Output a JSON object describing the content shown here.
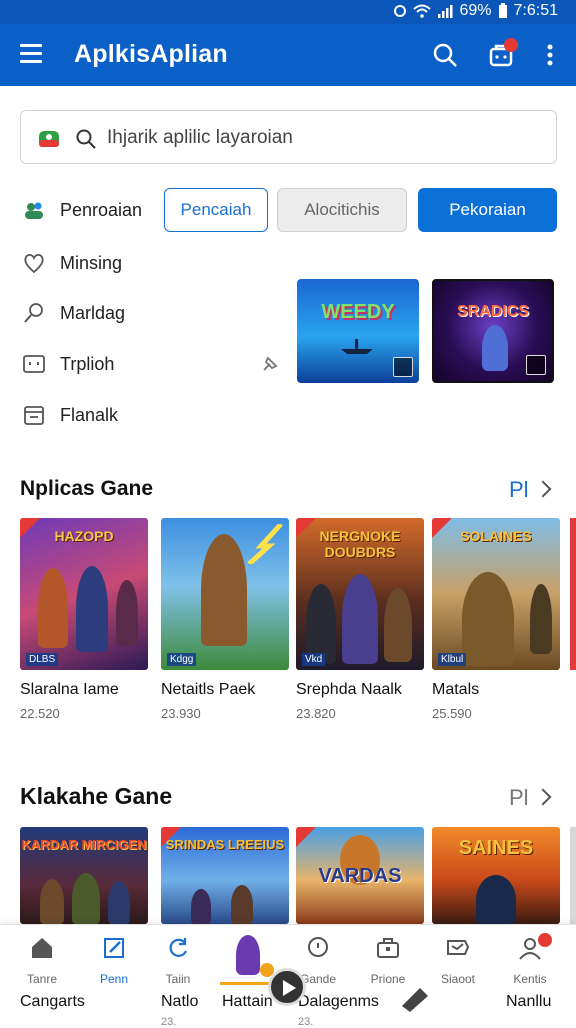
{
  "status_bar": {
    "battery": "69%",
    "time": "7:6:51"
  },
  "app_bar": {
    "title": "AplkisAplian",
    "cart_badge": ""
  },
  "search": {
    "placeholder": "Ihjarik aplilic layaroian"
  },
  "sidebar": {
    "items": [
      {
        "label": "Penroaian",
        "icon": "people-icon"
      },
      {
        "label": "Minsing",
        "icon": "heart-icon"
      },
      {
        "label": "Marldag",
        "icon": "magnifier-icon"
      },
      {
        "label": "Trplioh",
        "icon": "screen-icon"
      },
      {
        "label": "Flanalk",
        "icon": "calendar-icon"
      }
    ]
  },
  "chips": {
    "first": "Pencaiah",
    "second": "Alocitichis",
    "third": "Pekoraian"
  },
  "featured": [
    {
      "title": "WEEDY"
    },
    {
      "title": "SRADICS"
    }
  ],
  "sections": {
    "popular": {
      "title": "Nplicas Gane",
      "more": "Pl",
      "cards": [
        {
          "name": "Slaralna Iame",
          "count": "22.520",
          "art_text": "HAZOPD",
          "tag": "DLBS"
        },
        {
          "name": "Netaitls Paek",
          "count": "23.930",
          "art_text": "",
          "tag": "Kdgg"
        },
        {
          "name": "Srephda Naalk",
          "count": "23.820",
          "art_text": "NERGNOKE DOUBDRS",
          "tag": "Vkd"
        },
        {
          "name": "Matals",
          "count": "25.590",
          "art_text": "SOLAINES",
          "tag": "Klbul"
        }
      ]
    },
    "second": {
      "title": "Klakahe Gane",
      "more": "Pl",
      "cards": [
        {
          "art_text": "KARDAR MIRCIGEN"
        },
        {
          "art_text": "SRINDAS LREEIUS"
        },
        {
          "art_text": "VARDAS"
        },
        {
          "art_text": "SAINES"
        }
      ]
    }
  },
  "bottom_nav": {
    "items": [
      {
        "label": "Tanre",
        "icon": "home-icon"
      },
      {
        "label": "Penn",
        "icon": "edit-icon"
      },
      {
        "label": "Taiin",
        "icon": "refresh-icon"
      },
      {
        "label": "",
        "icon": "avatar"
      },
      {
        "label": "Gande",
        "icon": "chat-icon"
      },
      {
        "label": "Prione",
        "icon": "briefcase-icon"
      },
      {
        "label": "Siaoot",
        "icon": "send-icon"
      },
      {
        "label": "Kentis",
        "icon": "user-icon"
      }
    ],
    "under_labels": [
      "Cangarts",
      "Natlo",
      "Hattain",
      "Dalagenms",
      "Nanllu"
    ],
    "under_sub": [
      "23.",
      "23."
    ]
  },
  "colors": {
    "primary": "#0b60c8",
    "accent": "#1a6fd1",
    "badge": "#e53935"
  }
}
